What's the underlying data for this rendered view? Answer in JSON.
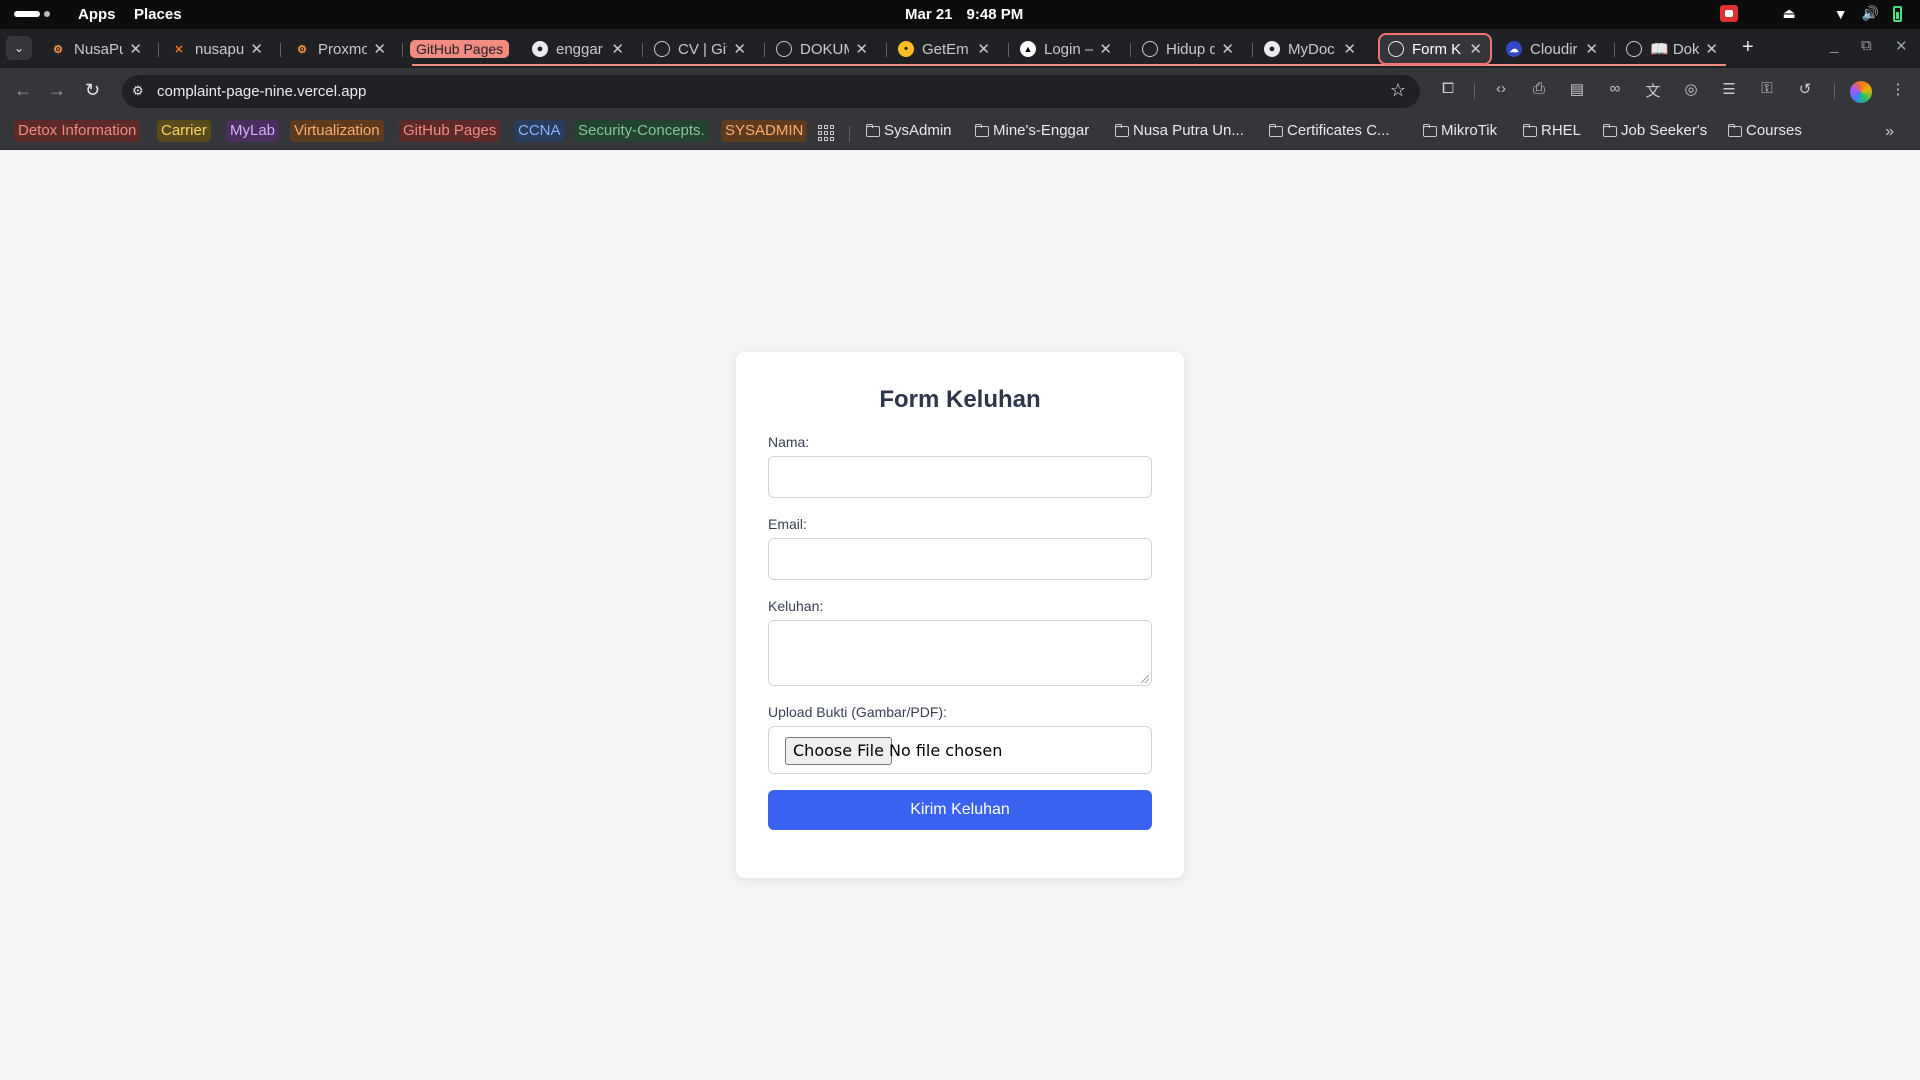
{
  "system_bar": {
    "apps": "Apps",
    "places": "Places",
    "date": "Mar 21",
    "time": "9:48 PM"
  },
  "tabs": [
    {
      "title": "NusaPu",
      "icon": "proxmox-icon"
    },
    {
      "title": "nusapu",
      "icon": "x-logo-icon"
    },
    {
      "title": "Proxmo",
      "icon": "proxmox-icon"
    },
    {
      "title": "GitHub Pages",
      "icon": "",
      "is_group_label": true
    },
    {
      "title": "enggar",
      "icon": "github-icon"
    },
    {
      "title": "CV | Git",
      "icon": "globe-icon"
    },
    {
      "title": "DOKUM",
      "icon": "globe-icon"
    },
    {
      "title": "GetEm",
      "icon": "emoji-icon"
    },
    {
      "title": "Login –",
      "icon": "vercel-icon"
    },
    {
      "title": "Hidup d",
      "icon": "globe-icon"
    },
    {
      "title": "MyDoc",
      "icon": "github-icon"
    },
    {
      "title": "Form K",
      "icon": "globe-icon",
      "active": true
    },
    {
      "title": "Cloudir",
      "icon": "cloudinary-icon"
    },
    {
      "title": "📖 Dok",
      "icon": "globe-icon"
    }
  ],
  "omnibox": {
    "url": "complaint-page-nine.vercel.app"
  },
  "bookmarks": {
    "colored": [
      {
        "label": "Detox Information",
        "color": "#f28b82",
        "bg": "#5c2b29"
      },
      {
        "label": "Carrier",
        "color": "#fdd663",
        "bg": "#594a1e"
      },
      {
        "label": "MyLab",
        "color": "#d7aefb",
        "bg": "#4a2e5e"
      },
      {
        "label": "Virtualization",
        "color": "#fcad70",
        "bg": "#5c3b1e"
      },
      {
        "label": "GitHub Pages",
        "color": "#f28b82",
        "bg": "#5c2b29"
      },
      {
        "label": "CCNA",
        "color": "#8ab4f8",
        "bg": "#283c5c"
      },
      {
        "label": "Security-Concepts.",
        "color": "#81c995",
        "bg": "#234230"
      },
      {
        "label": "SYSADMIN",
        "color": "#fcad70",
        "bg": "#5c3b1e"
      }
    ],
    "folders": [
      "SysAdmin",
      "Mine's-Enggar",
      "Nusa Putra Un...",
      "Certificates C...",
      "MikroTik",
      "RHEL",
      "Job Seeker's",
      "Courses"
    ]
  },
  "form": {
    "title": "Form Keluhan",
    "name_label": "Nama:",
    "email_label": "Email:",
    "complaint_label": "Keluhan:",
    "upload_label": "Upload Bukti (Gambar/PDF):",
    "file_button": "Choose File",
    "file_status": "No file chosen",
    "submit": "Kirim Keluhan"
  },
  "colors": {
    "page_bg": "#f3f4f6",
    "accent": "#3b63f1",
    "tab_group": "#f28b82"
  }
}
